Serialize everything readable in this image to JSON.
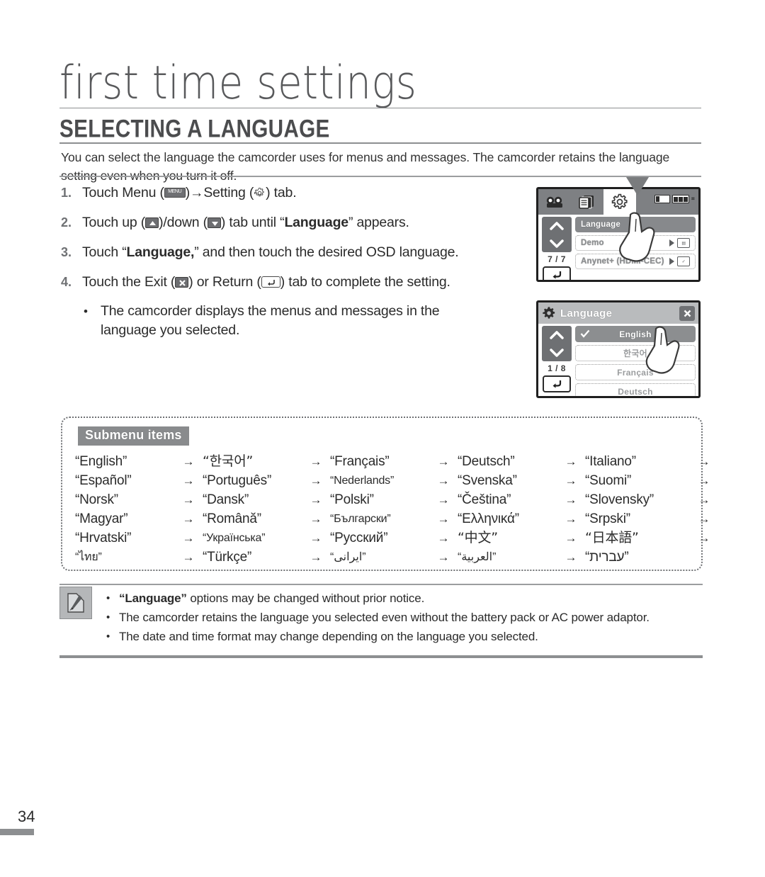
{
  "header": {
    "chapter_title": "first time settings",
    "section_title": "SELECTING A LANGUAGE",
    "intro": "You can select the language the camcorder uses for menus and messages. The camcorder retains the language setting even when you turn it off."
  },
  "steps": [
    {
      "num": "1.",
      "parts": [
        "Touch Menu (",
        "menu-icon",
        ")→Setting (",
        "gear-icon",
        ") tab."
      ],
      "pre": "Touch Menu (",
      "mid": ")→Setting (",
      "post": ") tab."
    },
    {
      "num": "2.",
      "pre": "Touch up (",
      "mid": ")/down (",
      "post_a": ") tab until “",
      "bold": "Language",
      "post_b": "” appears."
    },
    {
      "num": "3.",
      "pre": "Touch “",
      "bold": "Language,",
      "post": "” and then touch the desired OSD language."
    },
    {
      "num": "4.",
      "pre": "Touch the Exit (",
      "mid": ") or Return (",
      "post": ") tab to complete the setting."
    }
  ],
  "substep": {
    "bullet": "•",
    "text": "The camcorder displays the menus and messages in the language you selected."
  },
  "lcd_panel_1": {
    "tabs": [
      {
        "name": "camcorder-tab",
        "selected": false
      },
      {
        "name": "playback-tab",
        "selected": false
      },
      {
        "name": "setting-tab",
        "selected": true
      }
    ],
    "page_count": "7 / 7",
    "rows": [
      {
        "label": "Language",
        "highlighted": true,
        "has_arrow": false,
        "mini": ""
      },
      {
        "label": "Demo",
        "highlighted": false,
        "has_arrow": true,
        "mini": "■■■"
      },
      {
        "label": "Anynet+ (HDMI-CEC)",
        "highlighted": false,
        "has_arrow": true,
        "mini": "A✓"
      }
    ]
  },
  "lcd_panel_2": {
    "title": "Language",
    "close_label": "×",
    "page_count": "1 / 8",
    "rows": [
      {
        "label": "English",
        "highlighted": true,
        "checked": true
      },
      {
        "label": "한국어",
        "highlighted": false,
        "checked": false
      },
      {
        "label": "Français",
        "highlighted": false,
        "checked": false
      },
      {
        "label": "Deutsch",
        "highlighted": false,
        "checked": false
      }
    ]
  },
  "submenu": {
    "badge": "Submenu items",
    "arrow": "→",
    "languages": [
      [
        "“English”",
        "“한국어”",
        "“Français”",
        "“Deutsch”",
        "“Italiano”"
      ],
      [
        "“Español”",
        "“Português”",
        "“Nederlands”",
        "“Svenska”",
        "“Suomi”"
      ],
      [
        "“Norsk”",
        "“Dansk”",
        "“Polski”",
        "“Čeština”",
        "“Slovensky”"
      ],
      [
        "“Magyar”",
        "“Română”",
        "“Български”",
        "“Ελληνικά”",
        "“Srpski”"
      ],
      [
        "“Hrvatski”",
        "“Українська”",
        "“Русский”",
        "“中文”",
        "“日本語”"
      ],
      [
        "“ไทย”",
        "“Türkçe”",
        "“ایرانی”",
        "“العربية”",
        "“עברית”"
      ]
    ]
  },
  "notes": {
    "bullet": "•",
    "items": [
      {
        "bold": "“Language”",
        "text": " options may be changed without prior notice."
      },
      {
        "bold": "",
        "text": "The camcorder retains the language you selected even without the battery pack or AC power adaptor."
      },
      {
        "bold": "",
        "text": "The date and time format may change depending on the language you selected."
      }
    ]
  },
  "footer": {
    "page_number": "34"
  }
}
